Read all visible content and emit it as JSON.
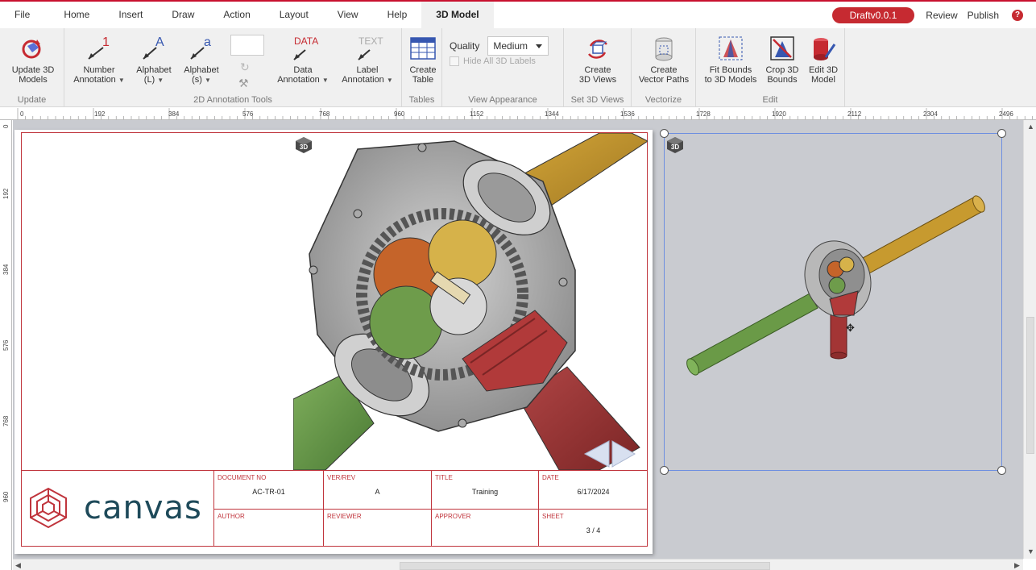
{
  "menu": {
    "items": [
      "File",
      "Home",
      "Insert",
      "Draw",
      "Action",
      "Layout",
      "View",
      "Help",
      "3D Model"
    ],
    "active": "3D Model",
    "draft_badge": "Draftv0.0.1",
    "review": "Review",
    "publish": "Publish",
    "help_glyph": "?"
  },
  "ribbon": {
    "update": {
      "button": [
        "Update 3D",
        "Models"
      ],
      "group": "Update"
    },
    "annotation": {
      "number": [
        "Number",
        "Annotation"
      ],
      "alpha_l": [
        "Alphabet",
        "(L)"
      ],
      "alpha_s": [
        "Alphabet",
        "(s)"
      ],
      "data": [
        "Data",
        "Annotation"
      ],
      "label": [
        "Label",
        "Annotation"
      ],
      "group": "2D Annotation Tools",
      "number_glyph": "1",
      "alpha_l_glyph": "A",
      "alpha_s_glyph": "a",
      "data_glyph": "DATA",
      "label_glyph": "TEXT"
    },
    "tables": {
      "button": [
        "Create",
        "Table"
      ],
      "group": "Tables"
    },
    "view_appearance": {
      "quality_label": "Quality",
      "quality_value": "Medium",
      "hide_labels": "Hide All 3D Labels",
      "group": "View Appearance"
    },
    "set3d": {
      "button": [
        "Create",
        "3D Views"
      ],
      "group": "Set 3D Views"
    },
    "vectorize": {
      "button": [
        "Create",
        "Vector Paths"
      ],
      "group": "Vectorize"
    },
    "edit": {
      "fit": [
        "Fit Bounds",
        "to 3D Models"
      ],
      "crop": [
        "Crop 3D",
        "Bounds"
      ],
      "edit3d": [
        "Edit 3D",
        "Model"
      ],
      "group": "Edit"
    }
  },
  "ruler": {
    "h_ticks": [
      "0",
      "192",
      "384",
      "576",
      "768",
      "960",
      "1152",
      "1344",
      "1536",
      "1728",
      "1920",
      "2112",
      "2304",
      "2496"
    ],
    "v_ticks": [
      "0",
      "192",
      "384",
      "576",
      "768",
      "960"
    ]
  },
  "title_block": {
    "document_no_label": "DOCUMENT NO",
    "document_no": "AC-TR-01",
    "ver_rev_label": "VER/REV",
    "ver_rev": "A",
    "title_label": "TITLE",
    "title": "Training",
    "date_label": "DATE",
    "date": "6/17/2024",
    "author_label": "AUTHOR",
    "reviewer_label": "REVIEWER",
    "approver_label": "APPROVER",
    "sheet_label": "SHEET",
    "sheet": "3 / 4",
    "logo_text": "canvas"
  },
  "badges": {
    "three_d": "3D"
  },
  "colors": {
    "brand_red": "#c62a31",
    "frame_red": "#c0353d",
    "logo_blue": "#1e4a5a",
    "selection_blue": "#6d8fe0"
  }
}
